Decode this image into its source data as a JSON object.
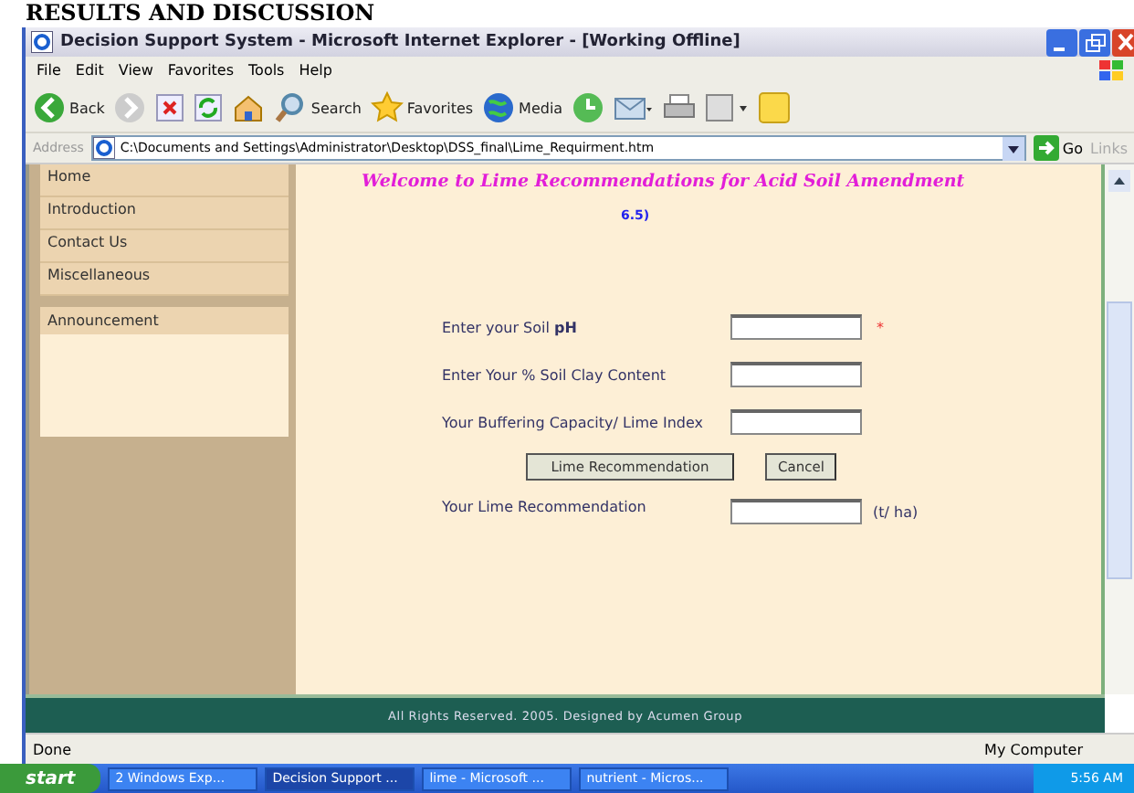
{
  "heading": "RESULTS AND DISCUSSION",
  "window": {
    "title": "Decision Support System - Microsoft Internet Explorer - [Working Offline]"
  },
  "menu": [
    "File",
    "Edit",
    "View",
    "Favorites",
    "Tools",
    "Help"
  ],
  "toolbar": [
    {
      "kind": "back",
      "label": "Back"
    },
    {
      "kind": "forward"
    },
    {
      "kind": "stop"
    },
    {
      "kind": "refresh"
    },
    {
      "kind": "home"
    },
    {
      "kind": "search",
      "label": "Search"
    },
    {
      "kind": "favorites",
      "label": "Favorites"
    },
    {
      "kind": "media",
      "label": "Media"
    },
    {
      "kind": "history"
    },
    {
      "kind": "mail"
    },
    {
      "kind": "print"
    },
    {
      "kind": "edit"
    },
    {
      "kind": "note"
    }
  ],
  "address": {
    "label": "Address",
    "url": "C:\\Documents and Settings\\Administrator\\Desktop\\DSS_final\\Lime_Requirment.htm",
    "go": "Go",
    "links": "Links"
  },
  "sidebar": {
    "items": [
      {
        "label": "Home"
      },
      {
        "label": "Introduction"
      },
      {
        "label": "Contact Us"
      },
      {
        "label": "Miscellaneous"
      }
    ],
    "section": "Announcement"
  },
  "page": {
    "title": "Welcome to Lime Recommendations for Acid Soil Amendment",
    "note": "6.5)"
  },
  "form": {
    "fields": [
      {
        "label": "Enter your Soil **pH**",
        "marker": "*"
      },
      {
        "label": "Enter Your % Soil Clay Content"
      },
      {
        "label": "Your Buffering Capacity/ Lime Index"
      }
    ],
    "buttons": [
      "Lime Recommendation",
      "Cancel"
    ],
    "result": {
      "label": "Your Lime Recommendation",
      "unit": "(t/ ha)"
    }
  },
  "footer": "All Rights Reserved. 2005. Designed by Acumen Group",
  "status_bar": {
    "left": "Done",
    "right": "My Computer"
  },
  "taskbar": {
    "start": "start",
    "tasks": [
      {
        "label": "2 Windows Exp...",
        "selected": false
      },
      {
        "label": "Decision Support ...",
        "selected": true
      },
      {
        "label": "lime - Microsoft ...",
        "selected": false
      },
      {
        "label": "nutrient - Micros...",
        "selected": false
      }
    ],
    "clock": "5:56 AM"
  }
}
